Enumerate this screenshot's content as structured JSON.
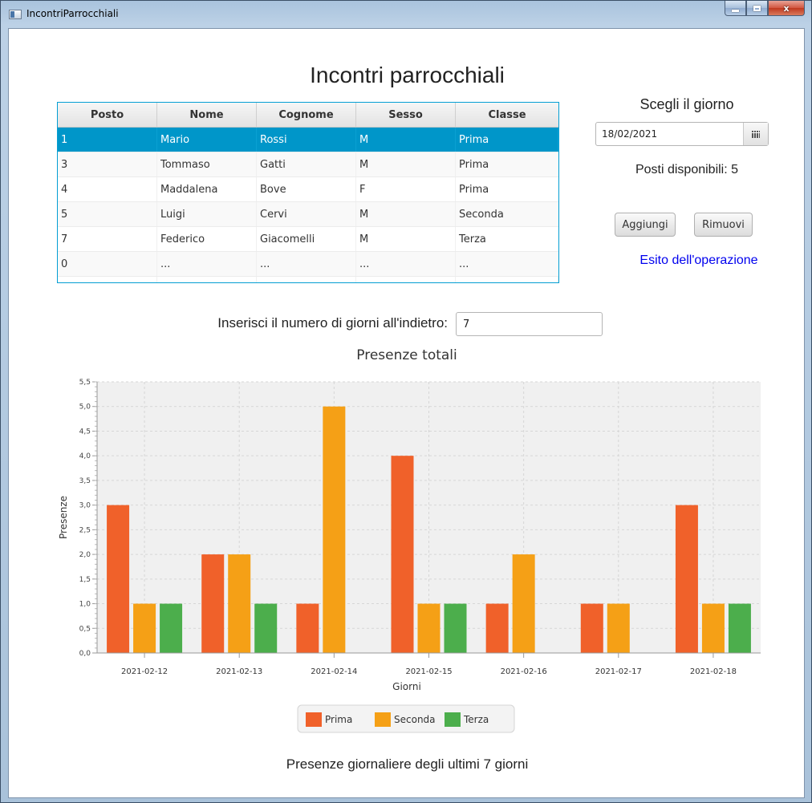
{
  "window": {
    "title": "IncontriParrocchiali",
    "close_label": "x"
  },
  "page": {
    "title": "Incontri parrocchiali"
  },
  "table": {
    "columns": [
      "Posto",
      "Nome",
      "Cognome",
      "Sesso",
      "Classe"
    ],
    "rows": [
      [
        "1",
        "Mario",
        "Rossi",
        "M",
        "Prima"
      ],
      [
        "3",
        "Tommaso",
        "Gatti",
        "M",
        "Prima"
      ],
      [
        "4",
        "Maddalena",
        "Bove",
        "F",
        "Prima"
      ],
      [
        "5",
        "Luigi",
        "Cervi",
        "M",
        "Seconda"
      ],
      [
        "7",
        "Federico",
        "Giacomelli",
        "M",
        "Terza"
      ],
      [
        "0",
        "...",
        "...",
        "...",
        "..."
      ]
    ],
    "selected_row": 0
  },
  "side": {
    "choose_day_label": "Scegli il giorno",
    "date_value": "18/02/2021",
    "available_seats": "Posti disponibili: 5",
    "add_button": "Aggiungi",
    "remove_button": "Rimuovi",
    "result_label": "Esito dell'operazione"
  },
  "days": {
    "label": "Inserisci il numero di giorni all'indietro:",
    "value": "7"
  },
  "chart_data": {
    "type": "bar",
    "title": "Presenze totali",
    "xlabel": "Giorni",
    "ylabel": "Presenze",
    "ylim": [
      0,
      5.5
    ],
    "yticks": [
      "0,0",
      "0,5",
      "1,0",
      "1,5",
      "2,0",
      "2,5",
      "3,0",
      "3,5",
      "4,0",
      "4,5",
      "5,0",
      "5,5"
    ],
    "categories": [
      "2021-02-12",
      "2021-02-13",
      "2021-02-14",
      "2021-02-15",
      "2021-02-16",
      "2021-02-17",
      "2021-02-18"
    ],
    "series": [
      {
        "name": "Prima",
        "color": "#f0612a",
        "values": [
          3,
          2,
          1,
          4,
          1,
          1,
          3
        ]
      },
      {
        "name": "Seconda",
        "color": "#f5a016",
        "values": [
          1,
          2,
          5,
          1,
          2,
          1,
          1
        ]
      },
      {
        "name": "Terza",
        "color": "#4cae4c",
        "values": [
          1,
          1,
          0,
          1,
          0,
          0,
          1
        ]
      }
    ],
    "grid": true,
    "legend": "bottom",
    "plot_background": "#f0f0f0"
  },
  "footer": {
    "text": "Presenze giornaliere degli ultimi 7 giorni"
  }
}
